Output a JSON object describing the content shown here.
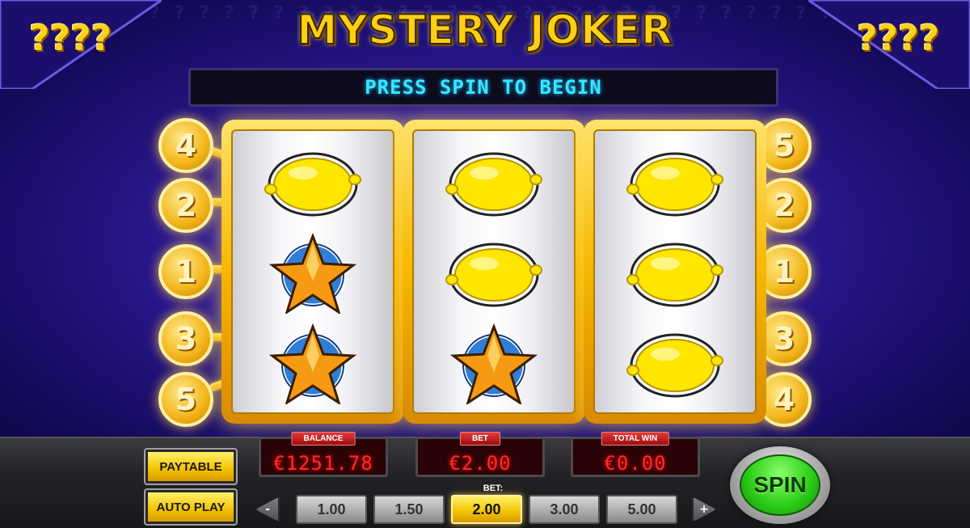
{
  "game": {
    "title": "MYSTERY JOKER",
    "message": "PRESS SPIN TO BEGIN",
    "corner_symbols": "????"
  },
  "reels": [
    {
      "symbols": [
        "lemon",
        "star",
        "star"
      ]
    },
    {
      "symbols": [
        "lemon",
        "lemon",
        "star"
      ]
    },
    {
      "symbols": [
        "lemon",
        "lemon",
        "lemon"
      ]
    }
  ],
  "paylines": {
    "left": [
      "4",
      "2",
      "1",
      "3",
      "5"
    ],
    "right": [
      "5",
      "2",
      "1",
      "3",
      "4"
    ]
  },
  "buttons": {
    "paytable": "PAYTABLE",
    "autoplay": "AUTO PLAY",
    "spin": "SPIN",
    "minus": "-",
    "plus": "+"
  },
  "meters": {
    "balance": {
      "label": "BALANCE",
      "value": "€1251.78"
    },
    "bet": {
      "label": "BET",
      "value": "€2.00"
    },
    "total_win": {
      "label": "TOTAL WIN",
      "value": "€0.00"
    }
  },
  "bet_selector": {
    "caption": "BET:",
    "options": [
      "1.00",
      "1.50",
      "2.00",
      "3.00",
      "5.00"
    ],
    "selected": "2.00"
  },
  "colors": {
    "gold": "#f3c200",
    "spin_green": "#2fcf1a",
    "led_red": "#ff2a2a",
    "led_cyan": "#38e6ff"
  }
}
